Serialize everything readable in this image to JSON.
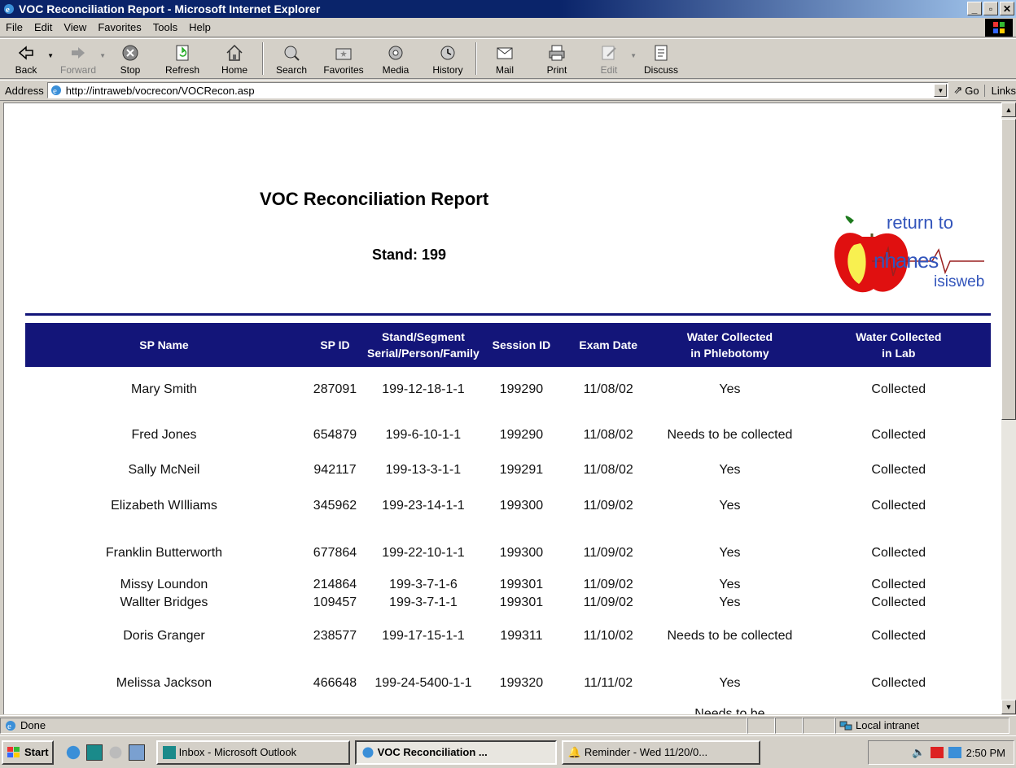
{
  "window": {
    "title": "VOC Reconciliation Report - Microsoft Internet Explorer"
  },
  "menu": [
    "File",
    "Edit",
    "View",
    "Favorites",
    "Tools",
    "Help"
  ],
  "toolbar": {
    "back": "Back",
    "forward": "Forward",
    "stop": "Stop",
    "refresh": "Refresh",
    "home": "Home",
    "search": "Search",
    "favorites": "Favorites",
    "media": "Media",
    "history": "History",
    "mail": "Mail",
    "print": "Print",
    "edit": "Edit",
    "discuss": "Discuss"
  },
  "address": {
    "label": "Address",
    "url": "http://intraweb/vocrecon/VOCRecon.asp",
    "go": "Go",
    "links": "Links"
  },
  "report": {
    "title": "VOC Reconciliation Report",
    "stand": "Stand: 199",
    "logo": {
      "line1": "return to",
      "line2": "nhanes",
      "line3": "isisweb"
    },
    "columns": [
      "SP Name",
      "SP ID",
      "Stand/Segment Serial/Person/Family",
      "Session ID",
      "Exam Date",
      "Water Collected in Phlebotomy",
      "Water Collected in Lab"
    ],
    "rows": [
      [
        "Mary Smith",
        "287091",
        "199-12-18-1-1",
        "199290",
        "11/08/02",
        "Yes",
        "Collected"
      ],
      [
        "Fred Jones",
        "654879",
        "199-6-10-1-1",
        "199290",
        "11/08/02",
        "Needs to be collected",
        "Collected"
      ],
      [
        "Sally McNeil",
        "942117",
        "199-13-3-1-1",
        "199291",
        "11/08/02",
        "Yes",
        "Collected"
      ],
      [
        "Elizabeth WIlliams",
        "345962",
        "199-23-14-1-1",
        "199300",
        "11/09/02",
        "Yes",
        "Collected"
      ],
      [
        "Franklin Butterworth",
        "677864",
        "199-22-10-1-1",
        "199300",
        "11/09/02",
        "Yes",
        "Collected"
      ],
      [
        "Missy Loundon",
        "214864",
        "199-3-7-1-6",
        "199301",
        "11/09/02",
        "Yes",
        "Collected"
      ],
      [
        "Wallter Bridges",
        "109457",
        "199-3-7-1-1",
        "199301",
        "11/09/02",
        "Yes",
        "Collected"
      ],
      [
        "Doris Granger",
        "238577",
        "199-17-15-1-1",
        "199311",
        "11/10/02",
        "Needs to be collected",
        "Collected"
      ],
      [
        "Melissa Jackson",
        "466648",
        "199-24-5400-1-1",
        "199320",
        "11/11/02",
        "Yes",
        "Collected"
      ],
      [
        "",
        "",
        "",
        "",
        "",
        "Needs to be",
        ""
      ]
    ]
  },
  "status": {
    "text": "Done",
    "zone": "Local intranet"
  },
  "taskbar": {
    "start": "Start",
    "tasks": [
      "Inbox - Microsoft Outlook",
      "VOC Reconciliation ...",
      "Reminder - Wed 11/20/0..."
    ],
    "clock": "2:50 PM"
  },
  "colors": {
    "header_bg": "#131579",
    "titlebar": "#0a246a",
    "chrome": "#d4d0c8"
  }
}
